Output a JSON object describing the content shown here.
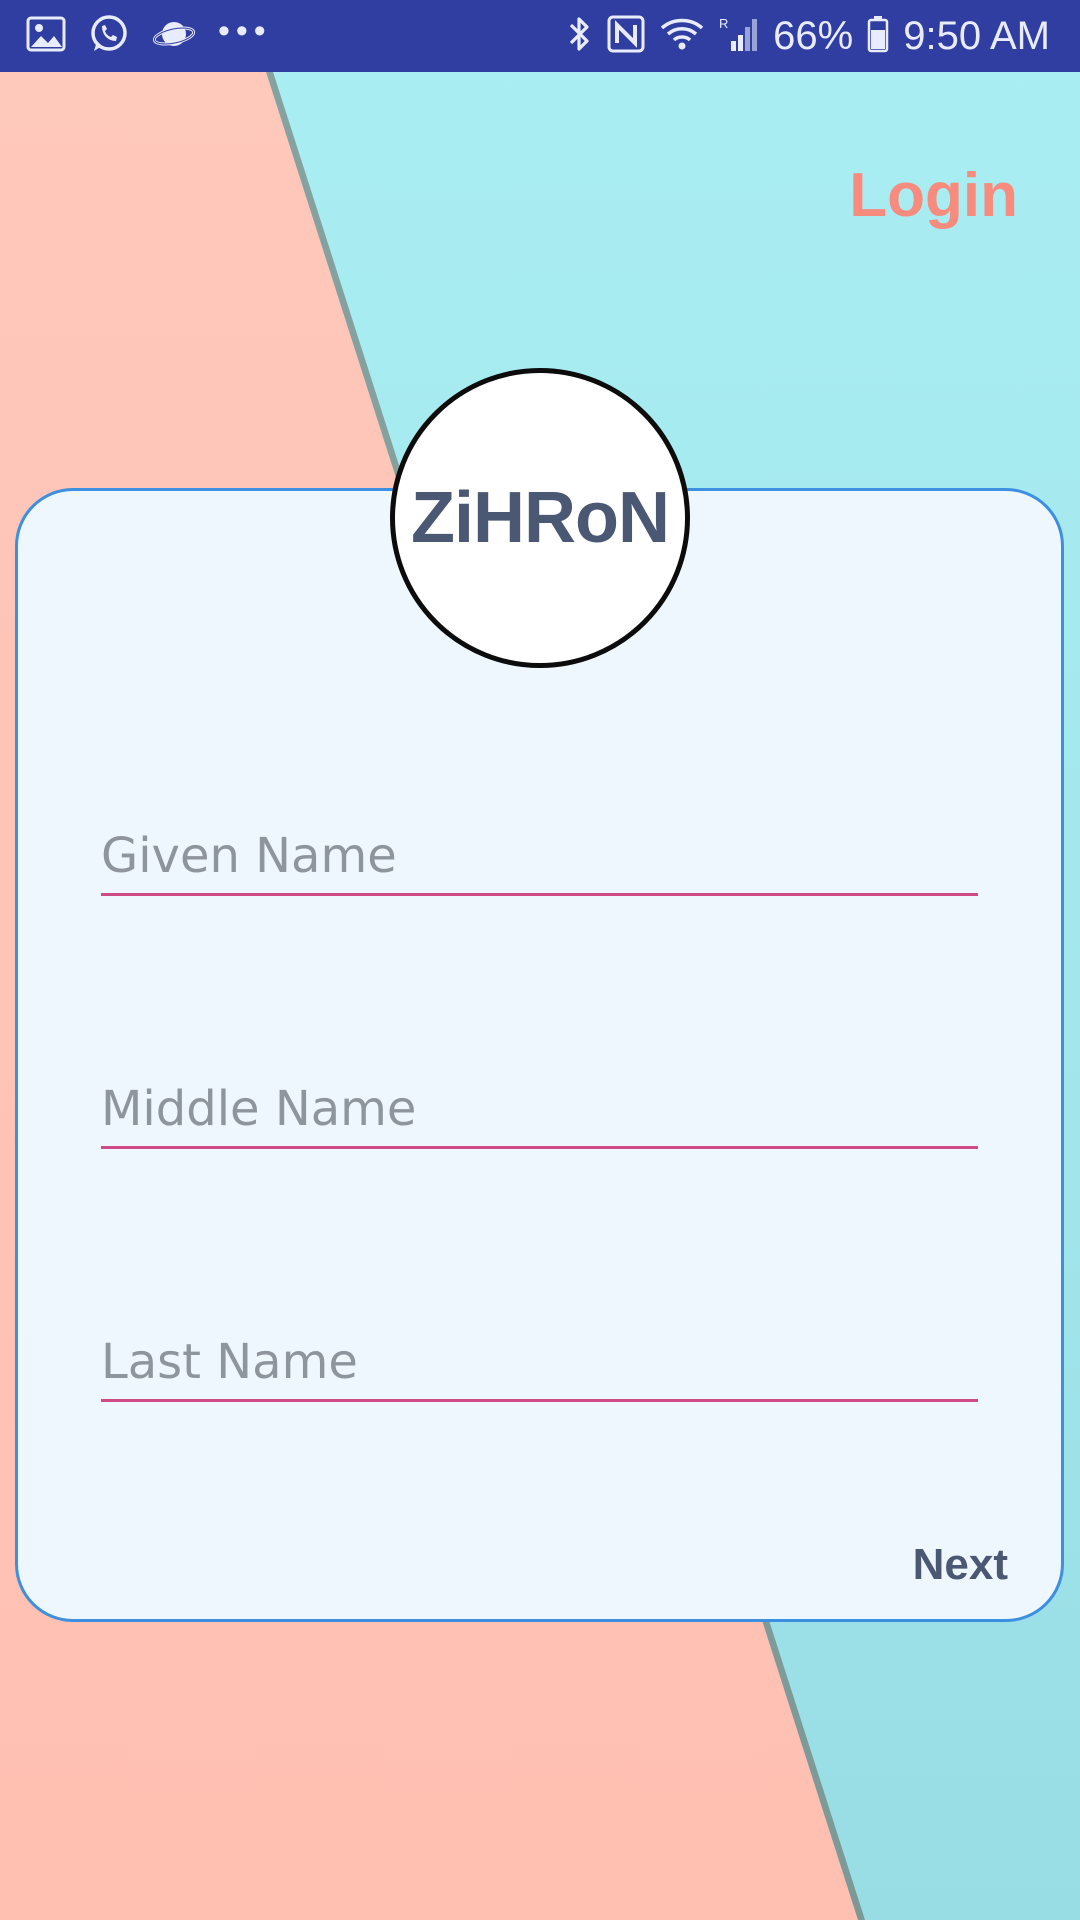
{
  "status_bar": {
    "battery": "66%",
    "time": "9:50 AM",
    "roaming": "R",
    "icons": [
      "gallery-icon",
      "whatsapp-icon",
      "planet-icon",
      "more-notifications-icon",
      "bluetooth-icon",
      "nfc-icon",
      "wifi-icon",
      "signal-icon",
      "battery-icon"
    ]
  },
  "header": {
    "login_label": "Login"
  },
  "logo": {
    "text": "ZiHRoN"
  },
  "form": {
    "given_name": {
      "placeholder": "Given Name",
      "value": ""
    },
    "middle_name": {
      "placeholder": "Middle Name",
      "value": ""
    },
    "last_name": {
      "placeholder": "Last Name",
      "value": ""
    },
    "next_label": "Next"
  },
  "colors": {
    "status_bar": "#2f3ea0",
    "background_left": "#fec5b6",
    "background_right": "#a6ebf1",
    "login_text": "#f78b7e",
    "card_border": "#3d8fe0",
    "field_underline": "#d14a88",
    "logo_text": "#4a5874"
  }
}
